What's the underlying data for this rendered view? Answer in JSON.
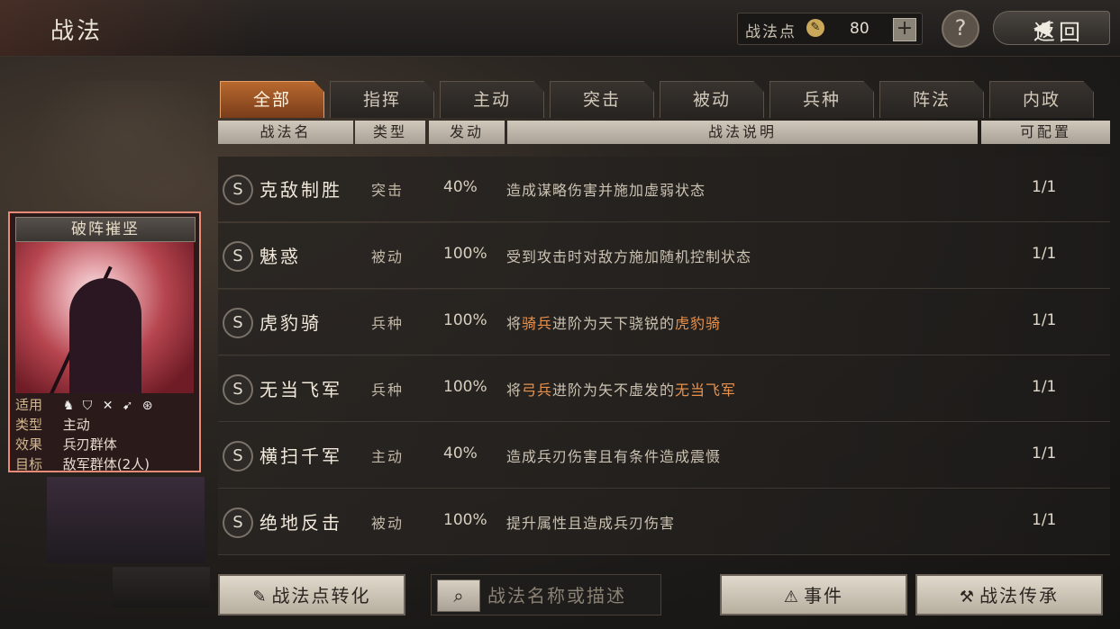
{
  "header": {
    "title": "战法",
    "points_label": "战法点",
    "points_icon": "brush-icon",
    "points_value": "80",
    "plus": "+",
    "help": "?",
    "back": "返回"
  },
  "card": {
    "title": "破阵摧坚",
    "usable_label": "适用",
    "usable_icons": [
      "cavalry-icon",
      "shield-icon",
      "crossbow-icon",
      "spear-icon",
      "wheel-icon"
    ],
    "type_label": "类型",
    "type_value": "主动",
    "effect_label": "效果",
    "effect_value": "兵刃群体",
    "target_label": "目标",
    "target_value": "敌军群体(2人)"
  },
  "tabs": [
    "全部",
    "指挥",
    "主动",
    "突击",
    "被动",
    "兵种",
    "阵法",
    "内政"
  ],
  "active_tab": "全部",
  "columns": [
    "战法名",
    "类型",
    "发动",
    "战法说明",
    "可配置"
  ],
  "rows": [
    {
      "grade": "S",
      "name": "克敌制胜",
      "type": "突击",
      "rate": "40%",
      "desc": [
        {
          "t": "造成谋略伤害并施加虚弱状态",
          "hl": false
        }
      ],
      "cfg": "1/1"
    },
    {
      "grade": "S",
      "name": "魅惑",
      "type": "被动",
      "rate": "100%",
      "desc": [
        {
          "t": "受到攻击时对敌方施加随机控制状态",
          "hl": false
        }
      ],
      "cfg": "1/1"
    },
    {
      "grade": "S",
      "name": "虎豹骑",
      "type": "兵种",
      "rate": "100%",
      "desc": [
        {
          "t": "将",
          "hl": false
        },
        {
          "t": "骑兵",
          "hl": true
        },
        {
          "t": "进阶为天下骁锐的",
          "hl": false
        },
        {
          "t": "虎豹骑",
          "hl": true
        }
      ],
      "cfg": "1/1"
    },
    {
      "grade": "S",
      "name": "无当飞军",
      "type": "兵种",
      "rate": "100%",
      "desc": [
        {
          "t": "将",
          "hl": false
        },
        {
          "t": "弓兵",
          "hl": true
        },
        {
          "t": "进阶为矢不虚发的",
          "hl": false
        },
        {
          "t": "无当飞军",
          "hl": true
        }
      ],
      "cfg": "1/1"
    },
    {
      "grade": "S",
      "name": "横扫千军",
      "type": "主动",
      "rate": "40%",
      "desc": [
        {
          "t": "造成兵刃伤害且有条件造成震慑",
          "hl": false
        }
      ],
      "cfg": "1/1"
    },
    {
      "grade": "S",
      "name": "绝地反击",
      "type": "被动",
      "rate": "100%",
      "desc": [
        {
          "t": "提升属性且造成兵刃伤害",
          "hl": false
        }
      ],
      "cfg": "1/1"
    }
  ],
  "bottom": {
    "convert": "战法点转化",
    "search_placeholder": "战法名称或描述",
    "events": "事件",
    "inherit": "战法传承"
  },
  "colors": {
    "accent": "#b8692e",
    "highlight": "#e8924e",
    "card_border": "#e98a76"
  }
}
